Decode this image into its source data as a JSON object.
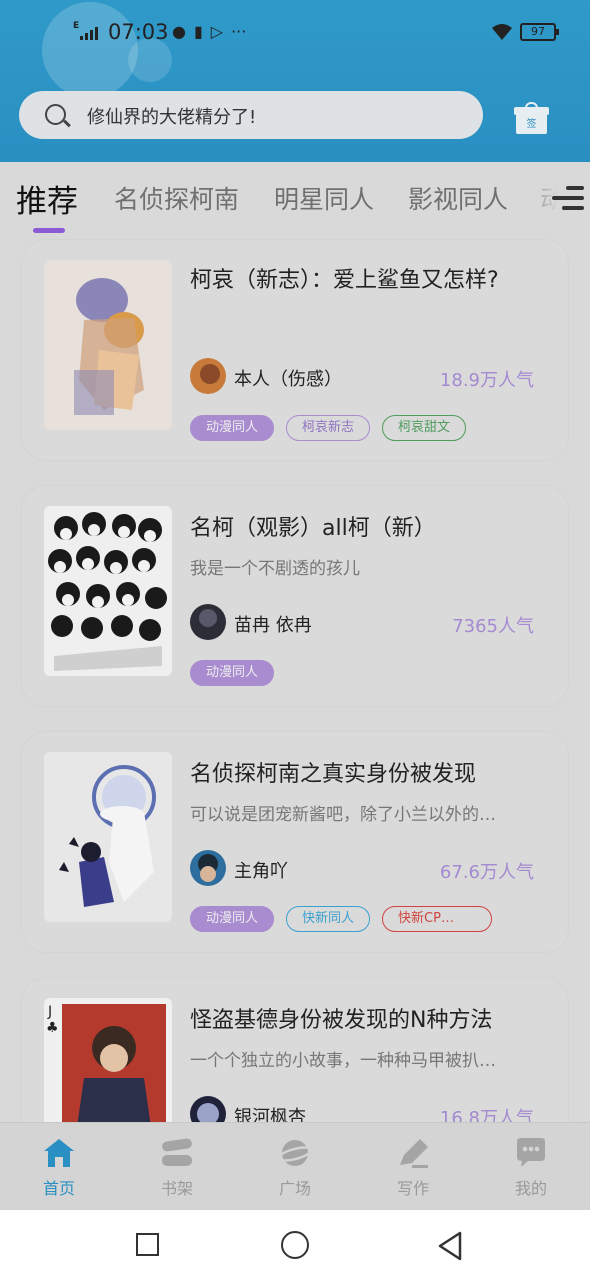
{
  "status": {
    "network": "E",
    "time": "07:03",
    "battery": "97"
  },
  "search": {
    "placeholder": "修仙界的大佬精分了!"
  },
  "gift": {
    "label": "签"
  },
  "tabs": [
    {
      "label": "推荐",
      "active": true
    },
    {
      "label": "名侦探柯南",
      "active": false
    },
    {
      "label": "明星同人",
      "active": false
    },
    {
      "label": "影视同人",
      "active": false
    },
    {
      "label": "动",
      "active": false
    }
  ],
  "books": [
    {
      "title": "柯哀（新志）：爱上鲨鱼又怎样?",
      "desc": "",
      "author": "本人（伤感）",
      "popularity": "18.9万人气",
      "tags": [
        {
          "label": "动漫同人",
          "style": "filled"
        },
        {
          "label": "柯哀新志",
          "style": "purple"
        },
        {
          "label": "柯哀甜文",
          "style": "green"
        }
      ]
    },
    {
      "title": "名柯（观影）all柯（新）",
      "desc": "我是一个不剧透的孩儿",
      "author": "苗冉  依冉",
      "popularity": "7365人气",
      "tags": [
        {
          "label": "动漫同人",
          "style": "filled"
        }
      ]
    },
    {
      "title": "名侦探柯南之真实身份被发现",
      "desc": "可以说是团宠新酱吧，除了小兰以外的…",
      "author": "主角吖",
      "popularity": "67.6万人气",
      "tags": [
        {
          "label": "动漫同人",
          "style": "filled"
        },
        {
          "label": "快新同人",
          "style": "blue"
        },
        {
          "label": "快新CP…",
          "style": "red"
        }
      ]
    },
    {
      "title": "怪盗基德身份被发现的N种方法",
      "desc": "一个个独立的小故事，一种种马甲被扒…",
      "author": "银河枫杏",
      "popularity": "16.8万人气",
      "tags": []
    }
  ],
  "bottom_nav": [
    {
      "label": "首页",
      "icon": "home-icon",
      "active": true
    },
    {
      "label": "书架",
      "icon": "bookshelf-icon",
      "active": false
    },
    {
      "label": "广场",
      "icon": "planet-icon",
      "active": false
    },
    {
      "label": "写作",
      "icon": "pen-icon",
      "active": false
    },
    {
      "label": "我的",
      "icon": "chat-bubble-icon",
      "active": false
    }
  ],
  "colors": {
    "header": "#2a8fc2",
    "accent_purple": "#8a5bd4",
    "active_nav": "#2a8fc2"
  }
}
